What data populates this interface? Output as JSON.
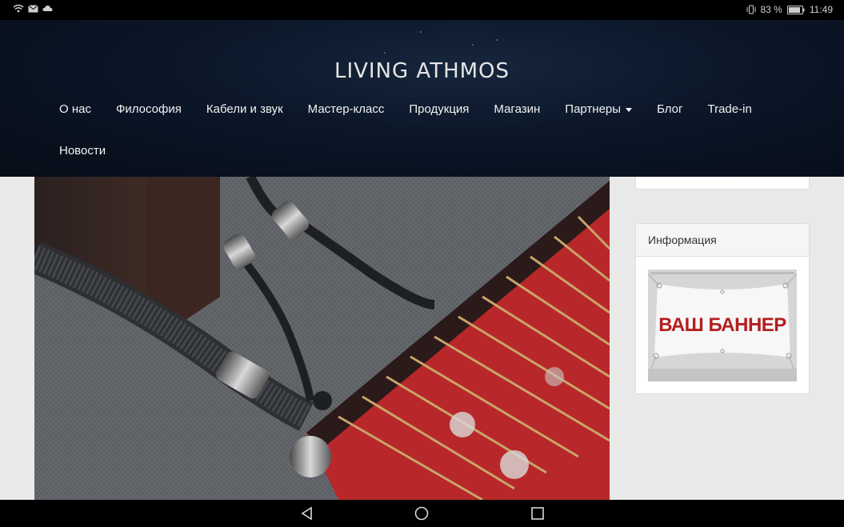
{
  "status_bar": {
    "battery_percent": "83 %",
    "time": "11:49",
    "left_icons": [
      "wifi-icon",
      "mail-icon",
      "cloud-icon"
    ],
    "right_icons": [
      "vibrate-icon",
      "battery-icon"
    ]
  },
  "header": {
    "logo_text": "LIVING ATHMOS",
    "nav": [
      {
        "label": "О нас"
      },
      {
        "label": "Философия"
      },
      {
        "label": "Кабели и звук"
      },
      {
        "label": "Мастер-класс"
      },
      {
        "label": "Продукция"
      },
      {
        "label": "Магазин"
      },
      {
        "label": "Партнеры",
        "has_dropdown": true
      },
      {
        "label": "Блог"
      },
      {
        "label": "Trade-in"
      },
      {
        "label": "Новости"
      }
    ]
  },
  "main": {
    "image_subject": "audio-cables-and-amplifier-photo"
  },
  "sidebar": {
    "info_widget": {
      "title": "Информация",
      "banner_text": "ВАШ БАННЕР"
    }
  },
  "colors": {
    "header_bg": "#0b1628",
    "banner_red": "#b41e1e",
    "page_bg": "#e9e9e9"
  },
  "android_nav": [
    "back-icon",
    "home-icon",
    "recents-icon"
  ]
}
